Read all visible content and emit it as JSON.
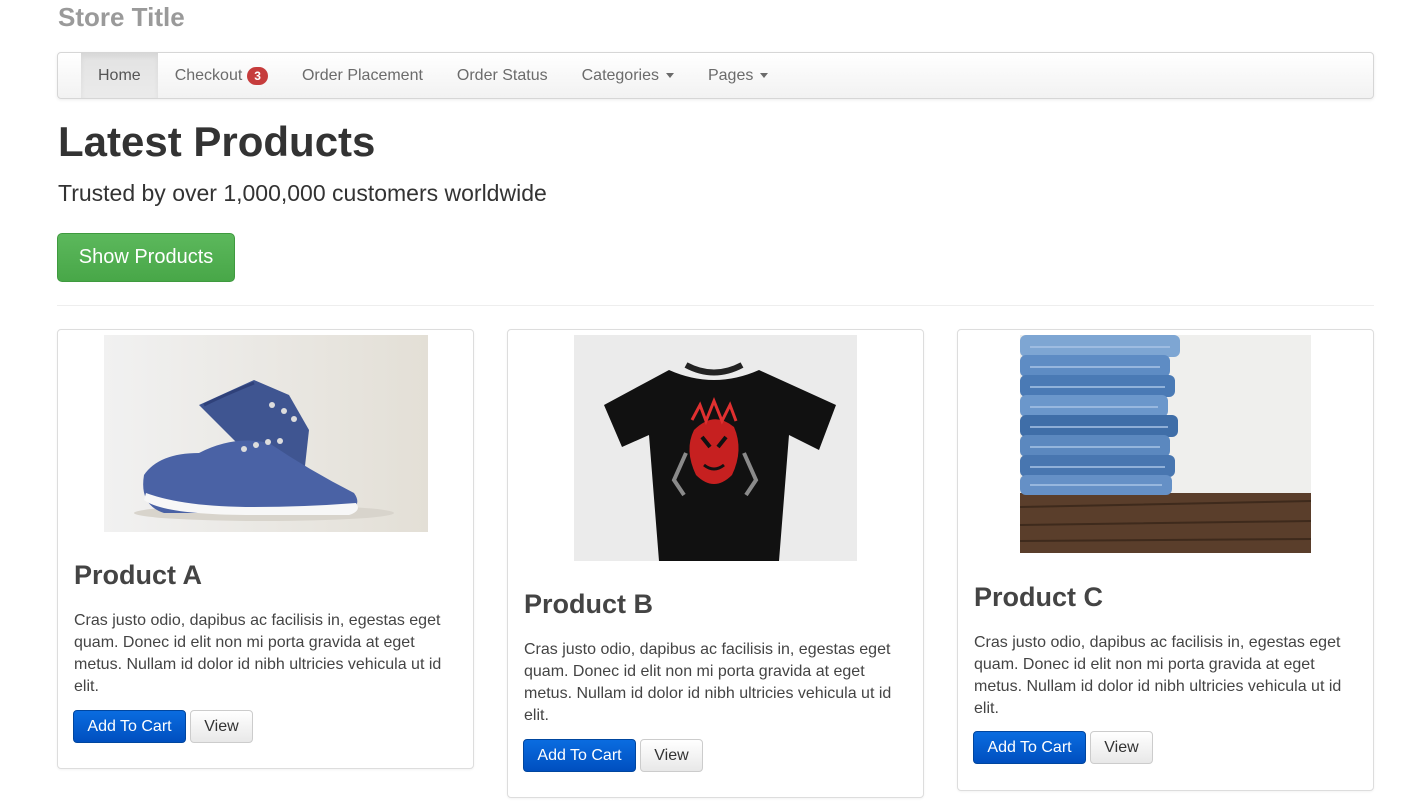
{
  "store": {
    "title": "Store Title"
  },
  "nav": {
    "items": [
      {
        "label": "Home"
      },
      {
        "label": "Checkout",
        "badge": "3"
      },
      {
        "label": "Order Placement"
      },
      {
        "label": "Order Status"
      },
      {
        "label": "Categories"
      },
      {
        "label": "Pages"
      }
    ]
  },
  "hero": {
    "heading": "Latest Products",
    "tagline": "Trusted by over 1,000,000 customers worldwide",
    "button_label": "Show Products"
  },
  "products": [
    {
      "name": "Product A",
      "image": "blue-sneakers-image",
      "description": "Cras justo odio, dapibus ac facilisis in, egestas eget quam. Donec id elit non mi porta gravida at eget metus. Nullam id dolor id nibh ultricies vehicula ut id elit.",
      "cart_label": "Add To Cart",
      "view_label": "View"
    },
    {
      "name": "Product B",
      "image": "black-tshirt-image",
      "description": "Cras justo odio, dapibus ac facilisis in, egestas eget quam. Donec id elit non mi porta gravida at eget metus. Nullam id dolor id nibh ultricies vehicula ut id elit.",
      "cart_label": "Add To Cart",
      "view_label": "View"
    },
    {
      "name": "Product C",
      "image": "folded-jeans-image",
      "description": "Cras justo odio, dapibus ac facilisis in, egestas eget quam. Donec id elit non mi porta gravida at eget metus. Nullam id dolor id nibh ultricies vehicula ut id elit.",
      "cart_label": "Add To Cart",
      "view_label": "View"
    }
  ],
  "colors": {
    "success": "#5cb85c",
    "primary": "#0a6ce0",
    "badge": "#c63c3c",
    "muted_title": "#9a9a9a"
  }
}
